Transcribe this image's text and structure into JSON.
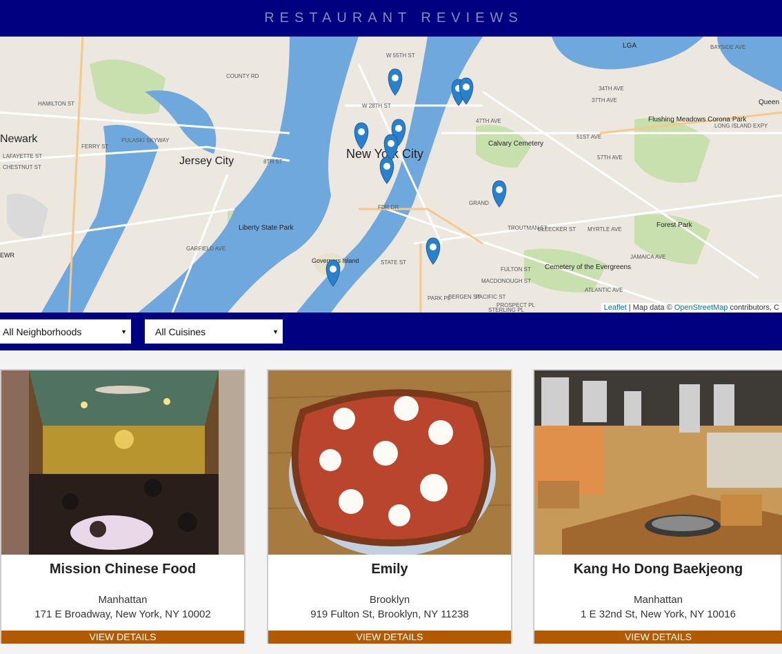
{
  "header": {
    "title": "RESTAURANT REVIEWS"
  },
  "map": {
    "place_labels": [
      "Newark",
      "Jersey City",
      "New York City",
      "Liberty State Park",
      "Governors Island",
      "Calvary Cemetery",
      "Flushing Meadows Corona Park",
      "Forest Park",
      "Cemetery of the Evergreens",
      "LGA",
      "EWR",
      "Queen"
    ],
    "street_labels": [
      "W 55TH ST",
      "W 28TH ST",
      "47TH AVE",
      "34TH AVE",
      "37TH AVE",
      "51ST AVE",
      "57TH AVE",
      "FDR DR",
      "GRAND",
      "MYRTLE AVE",
      "ATLANTIC AVE",
      "FULTON ST",
      "PARK PL",
      "STATE ST",
      "8TH ST",
      "PULASKI SKYWAY",
      "FERRY ST",
      "HAMILTON ST",
      "CHESTNUT ST",
      "LAFAYETTE ST",
      "LONG ISLAND EXPY",
      "JAMAICA AVE",
      "BLEECKER ST",
      "TROUTMAN ST",
      "MACDONOUGH ST",
      "BERGEN ST",
      "PACIFIC ST",
      "PROSPECT PL",
      "STERLING PL",
      "GARFIELD AVE",
      "BAYSIDE AVE",
      "COUNTY RD"
    ],
    "attribution": {
      "leaflet": "Leaflet",
      "separator": " | Map data © ",
      "osm": "OpenStreetMap",
      "suffix": " contributors, C"
    }
  },
  "filters": {
    "neighborhood": "All Neighborhoods",
    "cuisine": "All Cuisines"
  },
  "restaurants": [
    {
      "name": "Mission Chinese Food",
      "neighborhood": "Manhattan",
      "address": "171 E Broadway, New York, NY 10002",
      "button": "VIEW DETAILS"
    },
    {
      "name": "Emily",
      "neighborhood": "Brooklyn",
      "address": "919 Fulton St, Brooklyn, NY 11238",
      "button": "VIEW DETAILS"
    },
    {
      "name": "Kang Ho Dong Baekjeong",
      "neighborhood": "Manhattan",
      "address": "1 E 32nd St, New York, NY 10016",
      "button": "VIEW DETAILS"
    }
  ],
  "colors": {
    "header_bg": "#000080",
    "button_bg": "#b35900",
    "marker": "#2a81cb",
    "water": "#6fa8dc",
    "park": "#c8dfae"
  }
}
